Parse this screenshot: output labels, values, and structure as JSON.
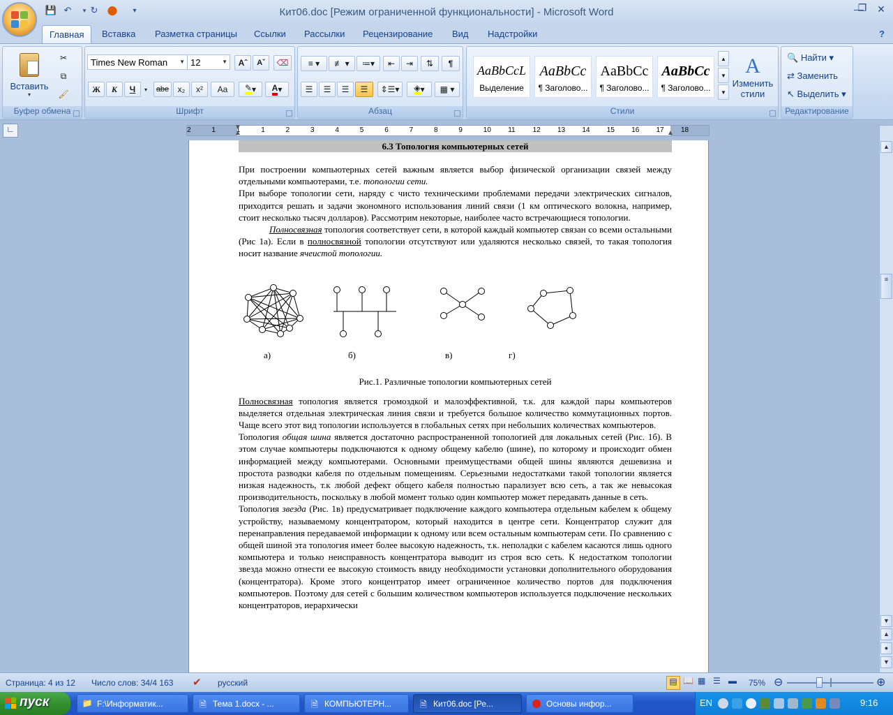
{
  "window": {
    "title": "Кит06.doc [Режим ограниченной функциональности] - Microsoft Word"
  },
  "qat": {
    "save_icon": "save-icon",
    "undo_icon": "undo-icon",
    "redo_icon": "redo-icon"
  },
  "tabs": [
    "Главная",
    "Вставка",
    "Разметка страницы",
    "Ссылки",
    "Рассылки",
    "Рецензирование",
    "Вид",
    "Надстройки"
  ],
  "clipboard": {
    "paste_label": "Вставить",
    "group_label": "Буфер обмена"
  },
  "font": {
    "name": "Times New Roman",
    "size": "12",
    "group_label": "Шрифт",
    "bold": "Ж",
    "italic": "К",
    "underline": "Ч",
    "strike": "abe",
    "sub": "x₂",
    "sup": "x²",
    "case": "Aa"
  },
  "paragraph": {
    "group_label": "Абзац"
  },
  "styles": {
    "group_label": "Стили",
    "change_label": "Изменить стили",
    "items": [
      {
        "sample": "AaBbCcL",
        "name": "Выделение"
      },
      {
        "sample": "AaBbCc",
        "name": "¶ Заголово..."
      },
      {
        "sample": "AaBbCc",
        "name": "¶ Заголово..."
      },
      {
        "sample": "AaBbCc",
        "name": "¶ Заголово..."
      }
    ]
  },
  "editing": {
    "group_label": "Редактирование",
    "find": "Найти",
    "replace": "Заменить",
    "select": "Выделить"
  },
  "ruler": {
    "ticks": [
      "2",
      "1",
      "1",
      "1",
      "2",
      "3",
      "4",
      "5",
      "6",
      "7",
      "8",
      "9",
      "10",
      "11",
      "12",
      "13",
      "14",
      "15",
      "16",
      "17",
      "18"
    ]
  },
  "doc": {
    "heading": "6.3 Топология компьютерных сетей",
    "p1a": "При построении компьютерных сетей важным является выбор физической организации связей между отдельными компьютерами, т.е. ",
    "p1b": "топологии сети.",
    "p2": "При выборе топологии сети, наряду с чисто техническими проблемами передачи электрических сигналов, приходится решать и задачи экономного использования линий связи (1 км оптического волокна, например, стоит несколько тысяч долларов). Рассмотрим некоторые, наиболее часто встречающиеся топологии.",
    "p3a": "Полносвязная",
    "p3b": " топология соответствует сети, в которой каждый компьютер связан со всеми остальными (Рис 1а). Если в ",
    "p3c": "полносвязной",
    "p3d": " топологии отсутствуют или удаляются несколько связей, то такая топология носит название ",
    "p3e": "ячеистой топологии.",
    "fig_labels": [
      "а)",
      "б)",
      "в)",
      "г)"
    ],
    "caption": "Рис.1. Различные топологии компьютерных сетей",
    "p4a": "Полносвязная",
    "p4b": " топология является громоздкой и малоэффективной, т.к. для каждой пары компьютеров выделяется отдельная электрическая линия связи и требуется большое количество коммутационных портов. Чаще всего этот вид топологии используется в глобальных сетях при небольших количествах компьютеров.",
    "p5a": "Топология ",
    "p5b": "общая шина",
    "p5c": " является достаточно распространенной топологией для локальных сетей (Рис. 1б). В этом случае компьютеры подключаются к одному общему кабелю (шине), по которому и происходит обмен информацией между компьютерами. Основными преимуществами общей шины являются дешевизна и простота разводки кабеля по отдельным помещениям. Серьезными недостатками такой топологии является низкая надежность, т.к любой дефект общего кабеля полностью парализует всю сеть, а так же невысокая производительность, поскольку в любой момент только один компьютер может передавать данные в сеть.",
    "p6a": "Топология ",
    "p6b": "звезда",
    "p6c": " (Рис. 1в) предусматривает подключение каждого компьютера отдельным кабелем к общему устройству, называемому концентратором, который находится в центре сети. Концентратор служит для перенаправления передаваемой информации к одному или всем остальным компьютерам сети. По сравнению с общей шиной эта топология имеет более высокую надежность, т.к. неполадки с кабелем касаются лишь одного компьютера и только неисправность концентратора выводит из строя всю сеть. К недостатком топологии звезда можно отнести ее высокую стоимость ввиду необходимости установки дополнительного оборудования (концентратора). Кроме этого концентратор имеет ограниченное количество портов для подключения компьютеров. Поэтому для сетей с большим количеством компьютеров используется подключение нескольких концентраторов, иерархически"
  },
  "status": {
    "page": "Страница: 4 из 12",
    "words": "Число слов: 34/4 163",
    "lang": "русский",
    "zoom": "75%"
  },
  "taskbar": {
    "start": "пуск",
    "tasks": [
      "F:\\Информатик...",
      "Тема 1.docx - ...",
      "КОМПЬЮТЕРН...",
      "Кит06.doc [Ре...",
      "Основы инфор..."
    ],
    "lang": "EN",
    "time": "9:16"
  }
}
